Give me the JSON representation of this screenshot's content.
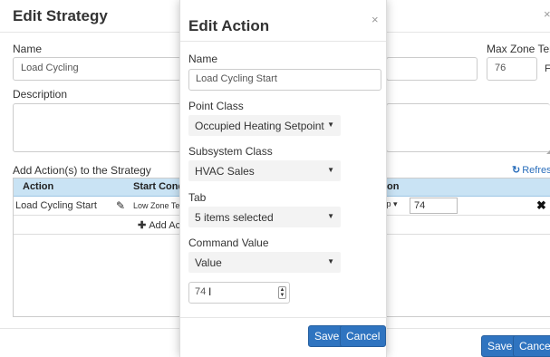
{
  "strategy": {
    "title": "Edit Strategy",
    "close_glyph": "×",
    "name_label": "Name",
    "name_value": "Load Cycling",
    "max_zone_temp_label": "Max Zone Temp",
    "max_zone_temp_value": "76",
    "max_zone_temp_unit": "F",
    "description_label": "Description",
    "actions_label": "Add Action(s) to the Strategy",
    "refresh_label": "Refresh",
    "grid": {
      "headers": [
        "Action",
        "Start Cond",
        "on"
      ],
      "row": {
        "action": "Load Cycling Start",
        "start_condition": "Low Zone Te",
        "operator": "mp ▾",
        "value": "74"
      },
      "add_action_label": "Add Ac"
    },
    "save_label": "Save",
    "cancel_label": "Cancel"
  },
  "modal": {
    "title": "Edit Action",
    "close_glyph": "×",
    "name_label": "Name",
    "name_value": "Load Cycling Start",
    "point_class_label": "Point Class",
    "point_class_value": "Occupied Heating Setpoint",
    "subsystem_class_label": "Subsystem Class",
    "subsystem_class_value": "HVAC Sales",
    "tab_label": "Tab",
    "tab_value": "5 items selected",
    "command_value_label": "Command Value",
    "command_value_select": "Value",
    "number_value": "74",
    "save_label": "Save",
    "cancel_label": "Cancel"
  },
  "colors": {
    "primary": "#2f74c0",
    "grid_header": "#c9e3f4",
    "link": "#2a6ebb"
  },
  "icons": {
    "refresh": "refresh-icon",
    "edit": "pencil-icon",
    "delete": "delete-icon",
    "add": "plus-icon",
    "close": "close-icon"
  }
}
